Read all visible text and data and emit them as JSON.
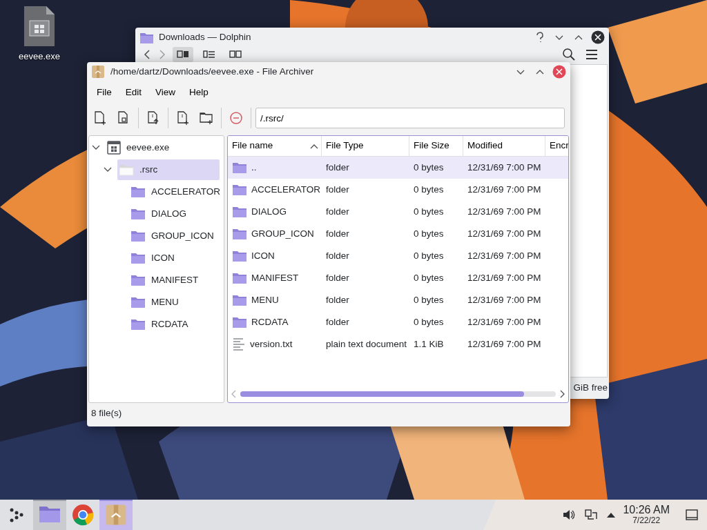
{
  "desktop_icons": [
    {
      "label": "eevee.exe"
    }
  ],
  "background_window": {
    "title": "Downloads — Dolphin",
    "status_text": "GiB free"
  },
  "window": {
    "title": "/home/dartz/Downloads/eevee.exe - File Archiver",
    "menu": [
      "File",
      "Edit",
      "View",
      "Help"
    ],
    "location": "/.rsrc/",
    "tree": [
      {
        "label": "eevee.exe",
        "kind": "archive",
        "expanded": true,
        "selected": false,
        "children": [
          {
            "label": ".rsrc",
            "kind": "folder-plain",
            "expanded": true,
            "selected": true,
            "children": [
              {
                "label": "ACCELERATOR",
                "kind": "folder",
                "selected": false
              },
              {
                "label": "DIALOG",
                "kind": "folder",
                "selected": false
              },
              {
                "label": "GROUP_ICON",
                "kind": "folder",
                "selected": false
              },
              {
                "label": "ICON",
                "kind": "folder",
                "selected": false
              },
              {
                "label": "MANIFEST",
                "kind": "folder",
                "selected": false
              },
              {
                "label": "MENU",
                "kind": "folder",
                "selected": false
              },
              {
                "label": "RCDATA",
                "kind": "folder",
                "selected": false
              }
            ]
          }
        ]
      }
    ],
    "table": {
      "columns": [
        {
          "label": "File name",
          "sorted": true
        },
        {
          "label": "File Type",
          "sorted": false
        },
        {
          "label": "File Size",
          "sorted": false
        },
        {
          "label": "Modified",
          "sorted": false
        },
        {
          "label": "Encr",
          "sorted": false
        }
      ],
      "rows": [
        {
          "kind": "folder",
          "name": "..",
          "type": "folder",
          "size": "0 bytes",
          "modified": "12/31/69 7:00 PM",
          "selected": true
        },
        {
          "kind": "folder",
          "name": "ACCELERATOR",
          "type": "folder",
          "size": "0 bytes",
          "modified": "12/31/69 7:00 PM",
          "selected": false
        },
        {
          "kind": "folder",
          "name": "DIALOG",
          "type": "folder",
          "size": "0 bytes",
          "modified": "12/31/69 7:00 PM",
          "selected": false
        },
        {
          "kind": "folder",
          "name": "GROUP_ICON",
          "type": "folder",
          "size": "0 bytes",
          "modified": "12/31/69 7:00 PM",
          "selected": false
        },
        {
          "kind": "folder",
          "name": "ICON",
          "type": "folder",
          "size": "0 bytes",
          "modified": "12/31/69 7:00 PM",
          "selected": false
        },
        {
          "kind": "folder",
          "name": "MANIFEST",
          "type": "folder",
          "size": "0 bytes",
          "modified": "12/31/69 7:00 PM",
          "selected": false
        },
        {
          "kind": "folder",
          "name": "MENU",
          "type": "folder",
          "size": "0 bytes",
          "modified": "12/31/69 7:00 PM",
          "selected": false
        },
        {
          "kind": "folder",
          "name": "RCDATA",
          "type": "folder",
          "size": "0 bytes",
          "modified": "12/31/69 7:00 PM",
          "selected": false
        },
        {
          "kind": "text",
          "name": "version.txt",
          "type": "plain text document",
          "size": "1.1 KiB",
          "modified": "12/31/69 7:00 PM",
          "selected": false
        }
      ]
    },
    "status": "8 file(s)"
  },
  "taskbar": {
    "tasks": [
      {
        "kind": "folder",
        "open": true,
        "selected": false
      },
      {
        "kind": "browser",
        "open": false,
        "selected": false
      },
      {
        "kind": "archive",
        "open": true,
        "selected": true
      }
    ],
    "time": "10:26 AM",
    "date": "7/22/22"
  }
}
